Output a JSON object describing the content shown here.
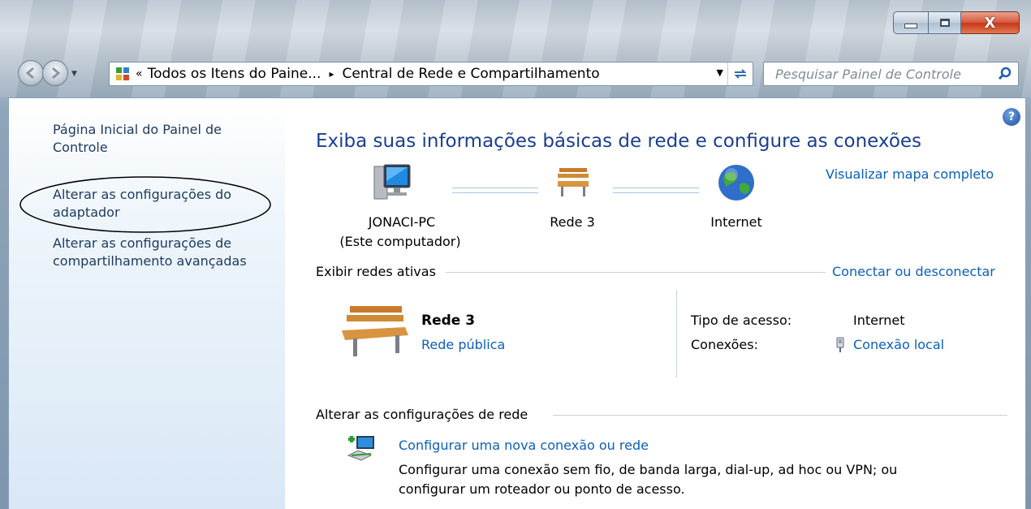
{
  "window": {
    "caption": {
      "minimize_icon": "minimize-icon",
      "maximize_icon": "maximize-icon",
      "close_label": "X"
    }
  },
  "navigation": {
    "breadcrumb_prefix": "«",
    "breadcrumb_item_1": "Todos os Itens do Paine...",
    "breadcrumb_arrow": "▸",
    "breadcrumb_item_2": "Central de Rede e Compartilhamento",
    "search_placeholder": "Pesquisar Painel de Controle"
  },
  "sidebar": {
    "items": [
      {
        "label_line1": "Página Inicial do Painel de",
        "label_line2": "Controle"
      },
      {
        "label_line1": "Alterar as configurações do",
        "label_line2": "adaptador"
      },
      {
        "label_line1": "Alterar as configurações de",
        "label_line2": "compartilhamento avançadas"
      }
    ]
  },
  "main": {
    "help_label": "?",
    "title": "Exiba suas informações básicas de rede e configure as conexões",
    "view_full_map": "Visualizar mapa completo",
    "map": {
      "computer_name": "JONACI-PC",
      "computer_sub": "(Este computador)",
      "network_name": "Rede 3",
      "internet_label": "Internet"
    },
    "active_networks": {
      "header": "Exibir redes ativas",
      "connect_link": "Conectar ou desconectar",
      "network_title": "Rede 3",
      "network_type": "Rede pública",
      "access_type_label": "Tipo de acesso:",
      "access_type_value": "Internet",
      "connections_label": "Conexões:",
      "connections_value": "Conexão local"
    },
    "change_settings": {
      "header": "Alterar as configurações de rede",
      "task_title": "Configurar uma nova conexão ou rede",
      "task_desc_line1": "Configurar uma conexão sem fio, de banda larga, dial-up, ad hoc ou VPN; ou",
      "task_desc_line2": "configurar um roteador ou ponto de acesso."
    }
  },
  "colors": {
    "link": "#0c5fb8",
    "title": "#1a3f8f",
    "sidebar_text": "#1e3b60"
  }
}
